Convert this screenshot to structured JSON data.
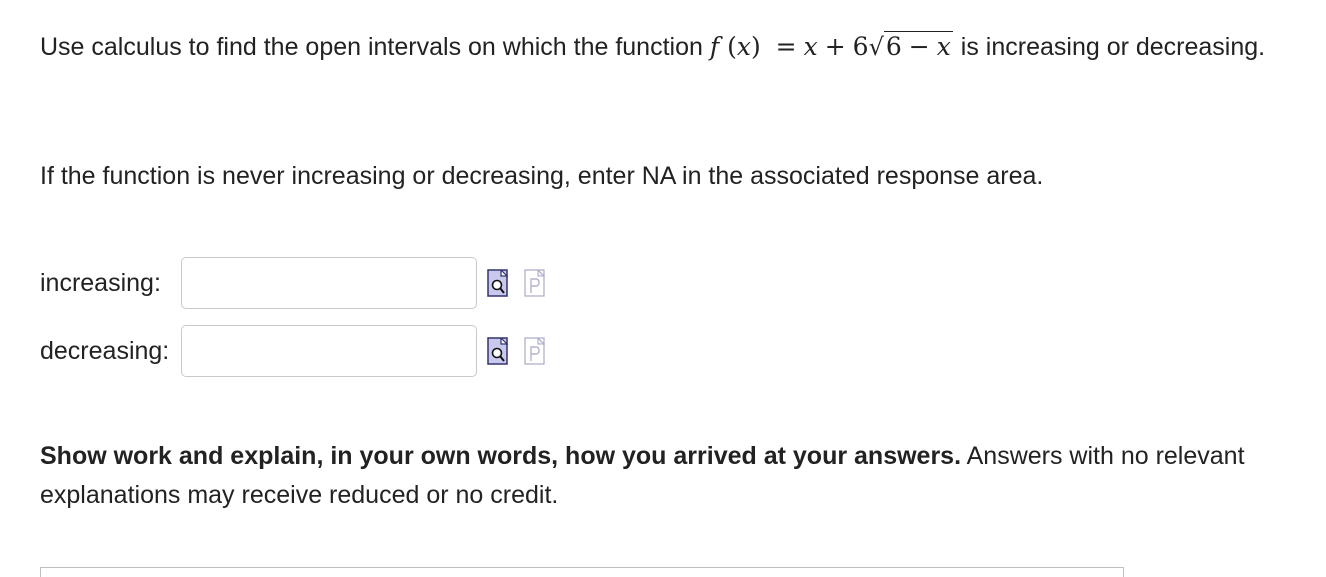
{
  "question": {
    "intro": "Use calculus to find the open intervals on which the function",
    "function_f": "f",
    "function_x": "x",
    "function_equals": "=",
    "function_term1": "x",
    "function_plus": "+",
    "function_coef": "6",
    "function_radicand_const": "6",
    "function_minus": "−",
    "function_radicand_var": "x",
    "outro": "is increasing or decreasing."
  },
  "note": "If the function is never increasing or decreasing, enter NA in the associated response area.",
  "answers": [
    {
      "label": "increasing:",
      "value": ""
    },
    {
      "label": "decreasing:",
      "value": ""
    }
  ],
  "icons": {
    "preview": "preview-icon",
    "palette": "palette-icon"
  },
  "work": {
    "bold": "Show work and explain, in your own words, how you arrived at your answers.",
    "rest": "Answers with no relevant explanations may receive reduced or no credit."
  },
  "colors": {
    "preview_fill": "#c9c9ee",
    "preview_stroke": "#33336e",
    "palette_stroke": "#a9a9c8",
    "input_border": "#c9c9c9"
  }
}
